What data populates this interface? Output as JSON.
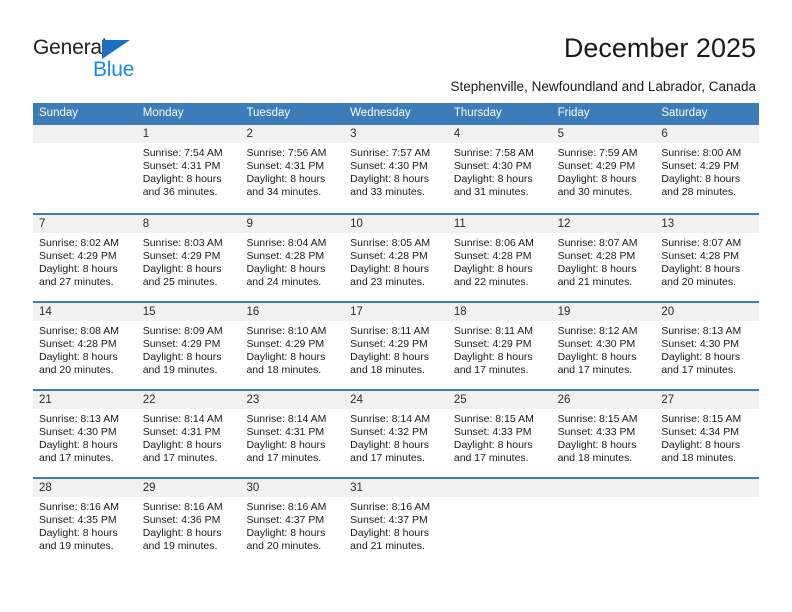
{
  "brand": {
    "name_top": "General",
    "name_bottom": "Blue",
    "triangle_color": "#1b6ec2",
    "blue_text_color": "#1b8bea"
  },
  "header": {
    "title": "December 2025",
    "subtitle": "Stephenville, Newfoundland and Labrador, Canada",
    "header_bg_color": "#3b7cb9"
  },
  "weekdays": [
    "Sunday",
    "Monday",
    "Tuesday",
    "Wednesday",
    "Thursday",
    "Friday",
    "Saturday"
  ],
  "weeks": [
    [
      {
        "day": "",
        "sunrise": "",
        "sunset": "",
        "daylight1": "",
        "daylight2": ""
      },
      {
        "day": "1",
        "sunrise": "Sunrise: 7:54 AM",
        "sunset": "Sunset: 4:31 PM",
        "daylight1": "Daylight: 8 hours",
        "daylight2": "and 36 minutes."
      },
      {
        "day": "2",
        "sunrise": "Sunrise: 7:56 AM",
        "sunset": "Sunset: 4:31 PM",
        "daylight1": "Daylight: 8 hours",
        "daylight2": "and 34 minutes."
      },
      {
        "day": "3",
        "sunrise": "Sunrise: 7:57 AM",
        "sunset": "Sunset: 4:30 PM",
        "daylight1": "Daylight: 8 hours",
        "daylight2": "and 33 minutes."
      },
      {
        "day": "4",
        "sunrise": "Sunrise: 7:58 AM",
        "sunset": "Sunset: 4:30 PM",
        "daylight1": "Daylight: 8 hours",
        "daylight2": "and 31 minutes."
      },
      {
        "day": "5",
        "sunrise": "Sunrise: 7:59 AM",
        "sunset": "Sunset: 4:29 PM",
        "daylight1": "Daylight: 8 hours",
        "daylight2": "and 30 minutes."
      },
      {
        "day": "6",
        "sunrise": "Sunrise: 8:00 AM",
        "sunset": "Sunset: 4:29 PM",
        "daylight1": "Daylight: 8 hours",
        "daylight2": "and 28 minutes."
      }
    ],
    [
      {
        "day": "7",
        "sunrise": "Sunrise: 8:02 AM",
        "sunset": "Sunset: 4:29 PM",
        "daylight1": "Daylight: 8 hours",
        "daylight2": "and 27 minutes."
      },
      {
        "day": "8",
        "sunrise": "Sunrise: 8:03 AM",
        "sunset": "Sunset: 4:29 PM",
        "daylight1": "Daylight: 8 hours",
        "daylight2": "and 25 minutes."
      },
      {
        "day": "9",
        "sunrise": "Sunrise: 8:04 AM",
        "sunset": "Sunset: 4:28 PM",
        "daylight1": "Daylight: 8 hours",
        "daylight2": "and 24 minutes."
      },
      {
        "day": "10",
        "sunrise": "Sunrise: 8:05 AM",
        "sunset": "Sunset: 4:28 PM",
        "daylight1": "Daylight: 8 hours",
        "daylight2": "and 23 minutes."
      },
      {
        "day": "11",
        "sunrise": "Sunrise: 8:06 AM",
        "sunset": "Sunset: 4:28 PM",
        "daylight1": "Daylight: 8 hours",
        "daylight2": "and 22 minutes."
      },
      {
        "day": "12",
        "sunrise": "Sunrise: 8:07 AM",
        "sunset": "Sunset: 4:28 PM",
        "daylight1": "Daylight: 8 hours",
        "daylight2": "and 21 minutes."
      },
      {
        "day": "13",
        "sunrise": "Sunrise: 8:07 AM",
        "sunset": "Sunset: 4:28 PM",
        "daylight1": "Daylight: 8 hours",
        "daylight2": "and 20 minutes."
      }
    ],
    [
      {
        "day": "14",
        "sunrise": "Sunrise: 8:08 AM",
        "sunset": "Sunset: 4:28 PM",
        "daylight1": "Daylight: 8 hours",
        "daylight2": "and 20 minutes."
      },
      {
        "day": "15",
        "sunrise": "Sunrise: 8:09 AM",
        "sunset": "Sunset: 4:29 PM",
        "daylight1": "Daylight: 8 hours",
        "daylight2": "and 19 minutes."
      },
      {
        "day": "16",
        "sunrise": "Sunrise: 8:10 AM",
        "sunset": "Sunset: 4:29 PM",
        "daylight1": "Daylight: 8 hours",
        "daylight2": "and 18 minutes."
      },
      {
        "day": "17",
        "sunrise": "Sunrise: 8:11 AM",
        "sunset": "Sunset: 4:29 PM",
        "daylight1": "Daylight: 8 hours",
        "daylight2": "and 18 minutes."
      },
      {
        "day": "18",
        "sunrise": "Sunrise: 8:11 AM",
        "sunset": "Sunset: 4:29 PM",
        "daylight1": "Daylight: 8 hours",
        "daylight2": "and 17 minutes."
      },
      {
        "day": "19",
        "sunrise": "Sunrise: 8:12 AM",
        "sunset": "Sunset: 4:30 PM",
        "daylight1": "Daylight: 8 hours",
        "daylight2": "and 17 minutes."
      },
      {
        "day": "20",
        "sunrise": "Sunrise: 8:13 AM",
        "sunset": "Sunset: 4:30 PM",
        "daylight1": "Daylight: 8 hours",
        "daylight2": "and 17 minutes."
      }
    ],
    [
      {
        "day": "21",
        "sunrise": "Sunrise: 8:13 AM",
        "sunset": "Sunset: 4:30 PM",
        "daylight1": "Daylight: 8 hours",
        "daylight2": "and 17 minutes."
      },
      {
        "day": "22",
        "sunrise": "Sunrise: 8:14 AM",
        "sunset": "Sunset: 4:31 PM",
        "daylight1": "Daylight: 8 hours",
        "daylight2": "and 17 minutes."
      },
      {
        "day": "23",
        "sunrise": "Sunrise: 8:14 AM",
        "sunset": "Sunset: 4:31 PM",
        "daylight1": "Daylight: 8 hours",
        "daylight2": "and 17 minutes."
      },
      {
        "day": "24",
        "sunrise": "Sunrise: 8:14 AM",
        "sunset": "Sunset: 4:32 PM",
        "daylight1": "Daylight: 8 hours",
        "daylight2": "and 17 minutes."
      },
      {
        "day": "25",
        "sunrise": "Sunrise: 8:15 AM",
        "sunset": "Sunset: 4:33 PM",
        "daylight1": "Daylight: 8 hours",
        "daylight2": "and 17 minutes."
      },
      {
        "day": "26",
        "sunrise": "Sunrise: 8:15 AM",
        "sunset": "Sunset: 4:33 PM",
        "daylight1": "Daylight: 8 hours",
        "daylight2": "and 18 minutes."
      },
      {
        "day": "27",
        "sunrise": "Sunrise: 8:15 AM",
        "sunset": "Sunset: 4:34 PM",
        "daylight1": "Daylight: 8 hours",
        "daylight2": "and 18 minutes."
      }
    ],
    [
      {
        "day": "28",
        "sunrise": "Sunrise: 8:16 AM",
        "sunset": "Sunset: 4:35 PM",
        "daylight1": "Daylight: 8 hours",
        "daylight2": "and 19 minutes."
      },
      {
        "day": "29",
        "sunrise": "Sunrise: 8:16 AM",
        "sunset": "Sunset: 4:36 PM",
        "daylight1": "Daylight: 8 hours",
        "daylight2": "and 19 minutes."
      },
      {
        "day": "30",
        "sunrise": "Sunrise: 8:16 AM",
        "sunset": "Sunset: 4:37 PM",
        "daylight1": "Daylight: 8 hours",
        "daylight2": "and 20 minutes."
      },
      {
        "day": "31",
        "sunrise": "Sunrise: 8:16 AM",
        "sunset": "Sunset: 4:37 PM",
        "daylight1": "Daylight: 8 hours",
        "daylight2": "and 21 minutes."
      },
      {
        "day": "",
        "sunrise": "",
        "sunset": "",
        "daylight1": "",
        "daylight2": ""
      },
      {
        "day": "",
        "sunrise": "",
        "sunset": "",
        "daylight1": "",
        "daylight2": ""
      },
      {
        "day": "",
        "sunrise": "",
        "sunset": "",
        "daylight1": "",
        "daylight2": ""
      }
    ]
  ]
}
